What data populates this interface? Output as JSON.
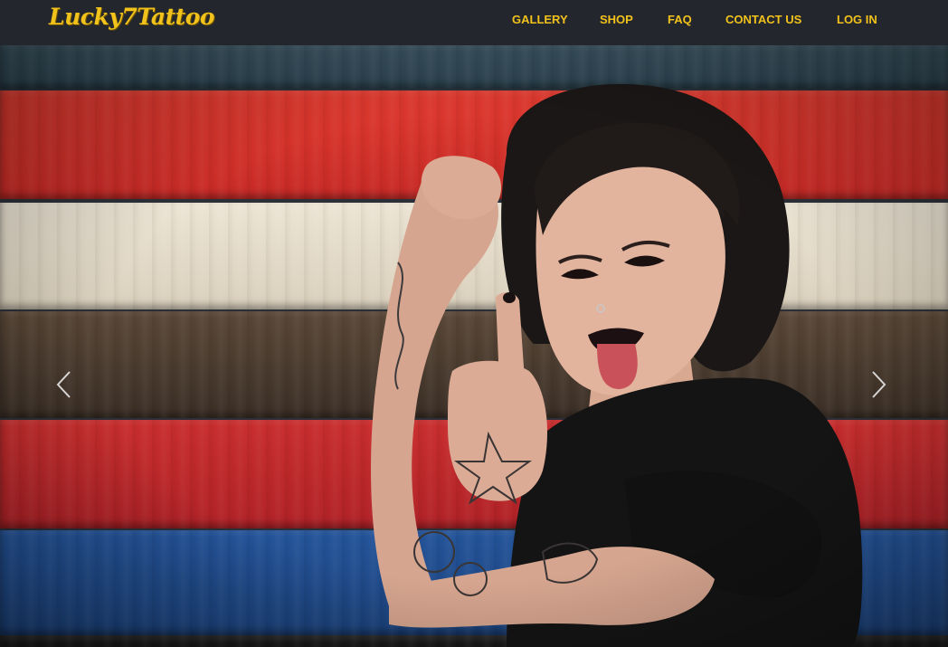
{
  "brand": {
    "logo_text": "Lucky7Tattoo",
    "color": "#f1c21b"
  },
  "nav": {
    "items": [
      {
        "label": "GALLERY"
      },
      {
        "label": "SHOP"
      },
      {
        "label": "FAQ"
      },
      {
        "label": "CONTACT US"
      },
      {
        "label": "LOG IN"
      }
    ],
    "background": "#23262d",
    "link_color": "#f1c21b"
  },
  "hero": {
    "image_subject": "tattooed woman in front of striped painted wood wall",
    "plank_colors": [
      "#314a58",
      "#d8332d",
      "#e4dccd",
      "#4a3b2f",
      "#c3272b",
      "#1e4a8a"
    ],
    "controls": {
      "prev_icon": "chevron-left-icon",
      "next_icon": "chevron-right-icon"
    }
  }
}
